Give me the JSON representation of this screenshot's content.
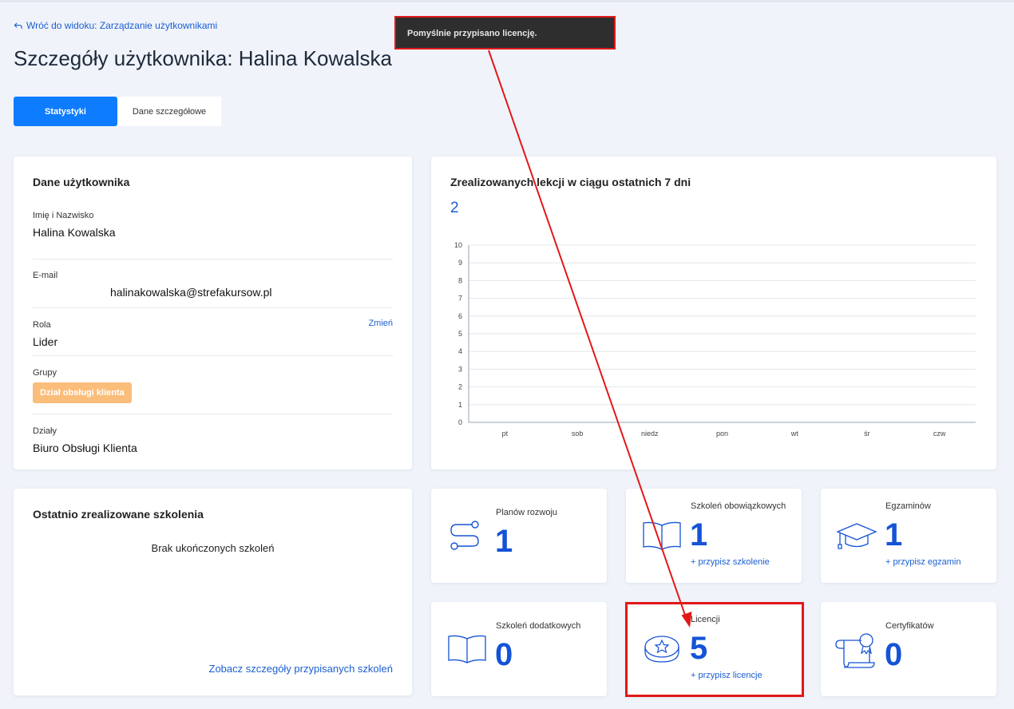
{
  "back_link": "Wróć do widoku: Zarządzanie użytkownikami",
  "page_title": "Szczegóły użytkownika: Halina Kowalska",
  "tabs": [
    {
      "label": "Statystyki",
      "active": true
    },
    {
      "label": "Dane szczegółowe",
      "active": false
    }
  ],
  "user_card": {
    "title": "Dane użytkownika",
    "name_label": "Imię i Nazwisko",
    "name_value": "Halina Kowalska",
    "email_label": "E-mail",
    "email_value": "halinakowalska@strefakursow.pl",
    "role_label": "Rola",
    "role_value": "Lider",
    "role_change": "Zmień",
    "groups_label": "Grupy",
    "group_badge": "Dział obsługi klienta",
    "departments_label": "Działy",
    "departments_value": "Biuro Obsługi Klienta"
  },
  "chart_card": {
    "title": "Zrealizowanych lekcji w ciągu ostatnich 7 dni",
    "value": "2"
  },
  "chart_data": {
    "type": "bar",
    "categories": [
      "pt",
      "sob",
      "niedz",
      "pon",
      "wt",
      "śr",
      "czw"
    ],
    "values": [
      0,
      0,
      0,
      0,
      0,
      0,
      0
    ],
    "ylim": [
      0,
      10
    ],
    "yticks": [
      0,
      1,
      2,
      3,
      4,
      5,
      6,
      7,
      8,
      9,
      10
    ],
    "grid": true
  },
  "recent_card": {
    "title": "Ostatnio zrealizowane szkolenia",
    "empty_text": "Brak ukończonych szkoleń",
    "link": "Zobacz szczegóły przypisanych szkoleń"
  },
  "stats": {
    "development_plans": {
      "label": "Planów rozwoju",
      "value": "1",
      "icon": "path-icon"
    },
    "mandatory": {
      "label": "Szkoleń obowiązkowych",
      "value": "1",
      "link": "+ przypisz szkolenie",
      "icon": "open-book-icon"
    },
    "exams": {
      "label": "Egzaminów",
      "value": "1",
      "link": "+ przypisz egzamin",
      "icon": "graduation-cap-icon"
    },
    "additional": {
      "label": "Szkoleń dodatkowych",
      "value": "0",
      "icon": "open-book-icon"
    },
    "licenses": {
      "label": "Licencji",
      "value": "5",
      "link": "+ przypisz licencje",
      "icon": "star-badge-icon"
    },
    "certificates": {
      "label": "Certyfikatów",
      "value": "0",
      "icon": "certificate-scroll-icon"
    }
  },
  "toast": {
    "message": "Pomyślnie przypisano licencję."
  },
  "colors": {
    "accent": "#0d7cff",
    "number_blue": "#1553d6",
    "badge_orange": "#fbbd7a",
    "annotation_red": "#e21818",
    "toast_bg": "#2e2e2e"
  }
}
